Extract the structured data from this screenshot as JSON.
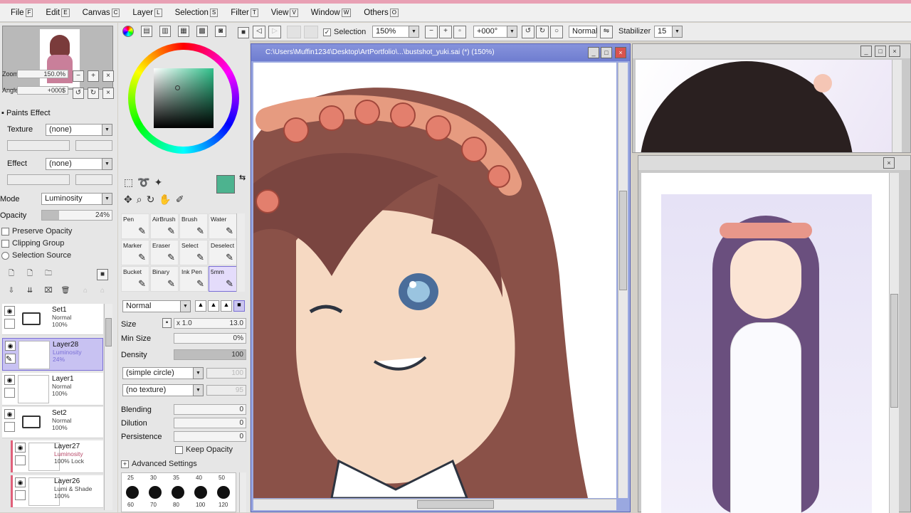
{
  "menu": [
    {
      "label": "File",
      "key": "F"
    },
    {
      "label": "Edit",
      "key": "E"
    },
    {
      "label": "Canvas",
      "key": "C"
    },
    {
      "label": "Layer",
      "key": "L"
    },
    {
      "label": "Selection",
      "key": "S"
    },
    {
      "label": "Filter",
      "key": "T"
    },
    {
      "label": "View",
      "key": "V"
    },
    {
      "label": "Window",
      "key": "W"
    },
    {
      "label": "Others",
      "key": "O"
    }
  ],
  "navigator": {
    "zoom_label": "Zoom",
    "zoom_value": "150.0%",
    "angle_label": "Angle",
    "angle_value": "+000$"
  },
  "paint_effect": {
    "header": "Paints Effect",
    "texture_label": "Texture",
    "texture_value": "(none)",
    "effect_label": "Effect",
    "effect_value": "(none)"
  },
  "layer_props": {
    "mode_label": "Mode",
    "mode_value": "Luminosity",
    "opacity_label": "Opacity",
    "opacity_value": "24%",
    "opacity_fraction": 0.24,
    "preserve_opacity": "Preserve Opacity",
    "clipping_group": "Clipping Group",
    "selection_source": "Selection Source"
  },
  "layers": [
    {
      "name": "Set1",
      "mode": "Normal",
      "opacity": "100%",
      "type": "folder"
    },
    {
      "name": "Layer28",
      "mode": "Luminosity",
      "opacity": "24%",
      "type": "layer",
      "selected": true
    },
    {
      "name": "Layer1",
      "mode": "Normal",
      "opacity": "100%",
      "type": "layer"
    },
    {
      "name": "Set2",
      "mode": "Normal",
      "opacity": "100%",
      "type": "folder"
    },
    {
      "name": "Layer27",
      "mode": "Luminosity",
      "opacity": "100% Lock",
      "type": "layer"
    },
    {
      "name": "Layer26",
      "mode": "Lumi & Shade",
      "opacity": "100%",
      "type": "layer"
    }
  ],
  "color": {
    "current": "#4db38f",
    "secondary": "#ffffff"
  },
  "tools": [
    {
      "label": "Pen"
    },
    {
      "label": "AirBrush"
    },
    {
      "label": "Brush"
    },
    {
      "label": "Water"
    },
    {
      "label": "Marker"
    },
    {
      "label": "Eraser"
    },
    {
      "label": "Select"
    },
    {
      "label": "Deselect"
    },
    {
      "label": "Bucket"
    },
    {
      "label": "Binary"
    },
    {
      "label": "Ink Pen"
    },
    {
      "label": "5mm",
      "selected": true
    }
  ],
  "brush": {
    "blend_mode": "Normal",
    "size_label": "Size",
    "size_mult": "x 1.0",
    "size_value": "13.0",
    "minsize_label": "Min Size",
    "minsize_value": "0%",
    "density_label": "Density",
    "density_value": "100",
    "shape": "(simple circle)",
    "shape_value": "100",
    "texture": "(no texture)",
    "texture_value": "95",
    "blending_label": "Blending",
    "blending_value": "0",
    "dilution_label": "Dilution",
    "dilution_value": "0",
    "persistence_label": "Persistence",
    "persistence_value": "0",
    "keep_opacity": "Keep Opacity",
    "advanced": "Advanced Settings",
    "dot_sizes_top": [
      "25",
      "30",
      "35",
      "40",
      "50"
    ],
    "dot_sizes_bottom": [
      "60",
      "70",
      "80",
      "100",
      "120"
    ]
  },
  "toolbar": {
    "selection_label": "Selection",
    "zoom": "150%",
    "angle": "+000°",
    "mode": "Normal",
    "stabilizer_label": "Stabilizer",
    "stabilizer_value": "15"
  },
  "canvas_window": {
    "title": "C:\\Users\\Muffin1234\\Desktop\\ArtPortfolio\\...\\bustshot_yuki.sai (*) (150%)"
  },
  "colors": {
    "accent": "#7a6fd6",
    "title_bar": "#7583d4",
    "layer_marker": "#e0607a"
  }
}
